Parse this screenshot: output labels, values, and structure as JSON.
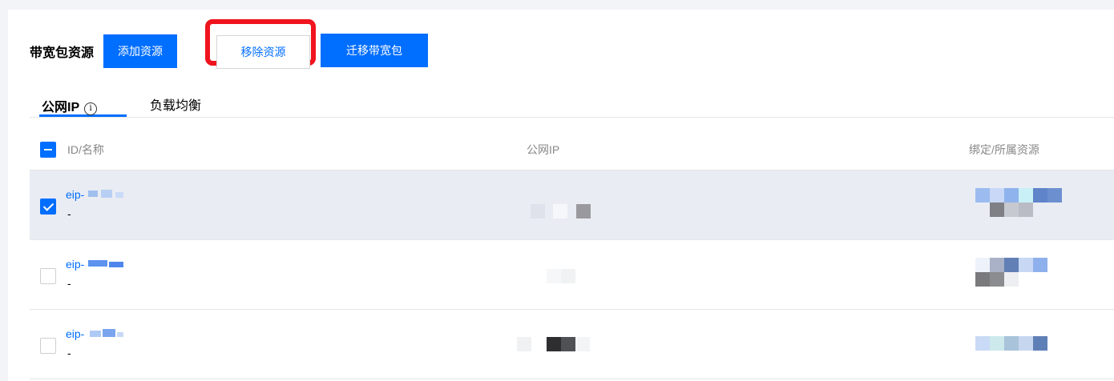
{
  "toolbar": {
    "title": "带宽包资源",
    "add_label": "添加资源",
    "remove_label": "移除资源",
    "migrate_label": "迁移带宽包"
  },
  "tabs": [
    {
      "label": "公网IP",
      "active": true,
      "info_icon": "info-icon"
    },
    {
      "label": "负载均衡",
      "active": false
    }
  ],
  "table": {
    "columns": [
      "ID/名称",
      "公网IP",
      "绑定/所属资源"
    ],
    "rows": [
      {
        "id_prefix": "eip-",
        "name": "-",
        "checked": true
      },
      {
        "id_prefix": "eip-",
        "name": "-",
        "checked": false
      },
      {
        "id_prefix": "eip-",
        "name": "-",
        "checked": false
      }
    ]
  },
  "colors": {
    "primary": "#006eff",
    "highlight_box": "#f0141e",
    "selected_row": "#e9ecf3"
  }
}
